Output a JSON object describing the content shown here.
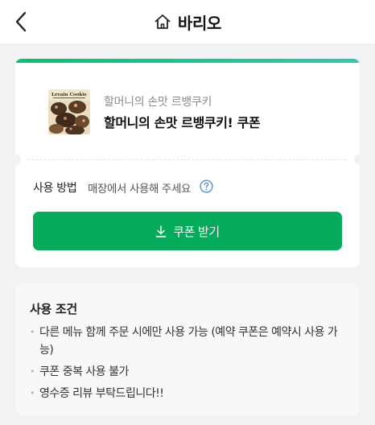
{
  "header": {
    "back_icon": "chevron-left-icon",
    "home_icon": "home-icon",
    "title": "바리오"
  },
  "coupon": {
    "thumbnail_text": "Levain Cookie",
    "brand": "할머니의 손맛 르뱅쿠키",
    "name": "할머니의 손맛 르뱅쿠키! 쿠폰",
    "usage_label": "사용 방법",
    "usage_value": "매장에서 사용해 주세요",
    "help_icon": "question-circle-icon",
    "download_icon": "download-icon",
    "button_label": "쿠폰 받기",
    "colors": {
      "accent": "#03ab5a",
      "accent_gradient_end": "#2ec8b6"
    }
  },
  "conditions": {
    "title": "사용 조건",
    "items": [
      "다른 메뉴 함께 주문 시에만 사용 가능 (예약 쿠폰은 예약시 사용 가능)",
      "쿠폰 중복 사용 불가",
      "영수증 리뷰 부탁드립니다!!"
    ]
  }
}
